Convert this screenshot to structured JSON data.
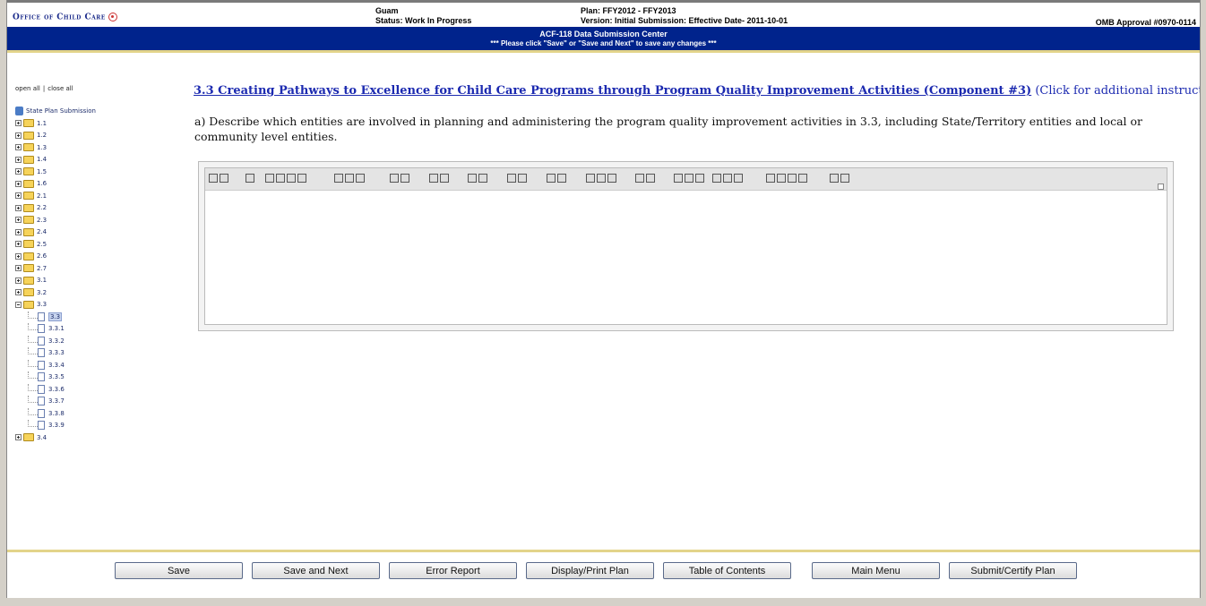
{
  "header": {
    "logo_text": "Office of Child Care",
    "state": "Guam",
    "status": "Status: Work In Progress",
    "plan": "Plan: FFY2012 - FFY2013",
    "version": "Version: Initial Submission: Effective Date- 2011-10-01",
    "omb": "OMB Approval #0970-0114"
  },
  "banner": {
    "title": "ACF-118 Data Submission Center",
    "subtitle": "*** Please click \"Save\" or \"Save and Next\" to save any changes ***"
  },
  "tree": {
    "open_all": "open all",
    "separator": "|",
    "close_all": "close all",
    "root": "State Plan Submission",
    "folders_before": [
      "1.1",
      "1.2",
      "1.3",
      "1.4",
      "1.5",
      "1.6",
      "2.1",
      "2.2",
      "2.3",
      "2.4",
      "2.5",
      "2.6",
      "2.7",
      "3.1",
      "3.2"
    ],
    "open_folder": "3.3",
    "open_children": [
      "3.3",
      "3.3.1",
      "3.3.2",
      "3.3.3",
      "3.3.4",
      "3.3.5",
      "3.3.6",
      "3.3.7",
      "3.3.8",
      "3.3.9"
    ],
    "folders_after": [
      "3.4"
    ]
  },
  "content": {
    "section_link": "3.3 Creating Pathways to Excellence for Child Care Programs through Program Quality Improvement Activities (Component #3)",
    "section_note": "(Click for additional instructions)",
    "question": "a) Describe which entities are involved in planning and administering the program quality improvement activities in 3.3, including State/Territory entities and local or community level entities."
  },
  "editor": {
    "value": ""
  },
  "buttons": {
    "save": "Save",
    "save_next": "Save and Next",
    "error_report": "Error Report",
    "display_print": "Display/Print Plan",
    "toc": "Table of Contents",
    "main_menu": "Main Menu",
    "submit": "Submit/Certify Plan"
  },
  "colors": {
    "banner": "#00238c",
    "accent_line": "#e3d48a",
    "link": "#1c2ab0"
  }
}
